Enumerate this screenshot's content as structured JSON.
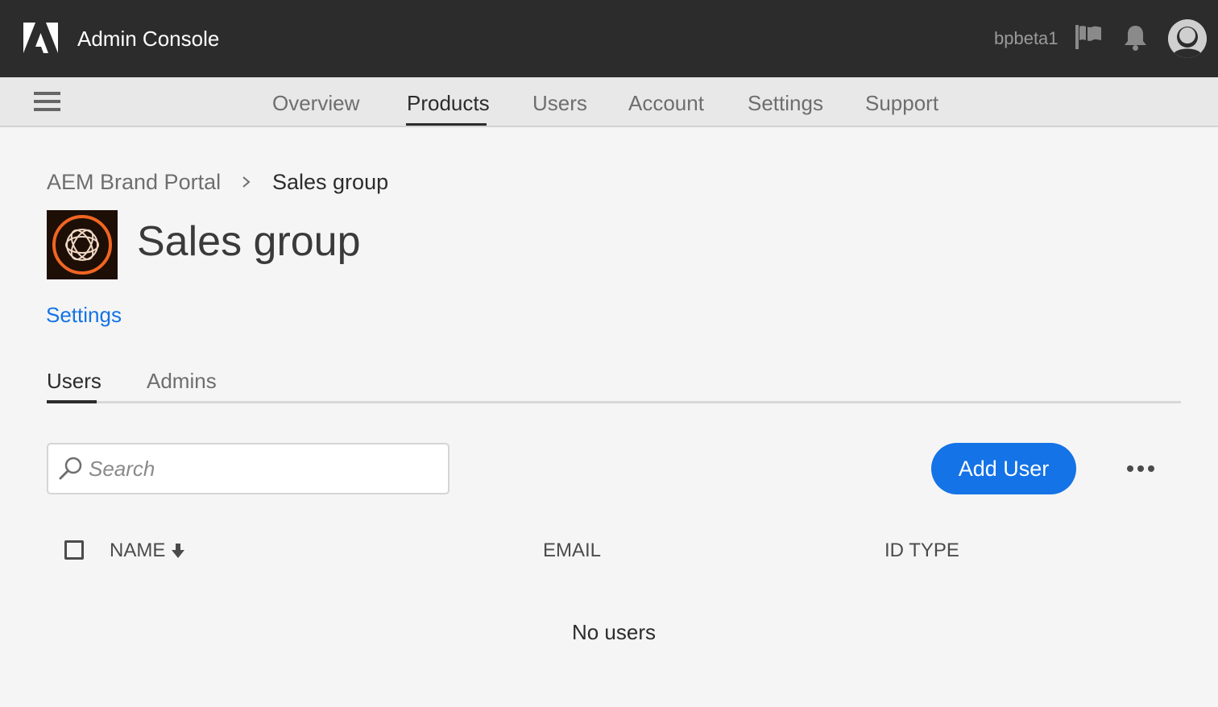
{
  "header": {
    "app_title": "Admin Console",
    "username": "bpbeta1",
    "logo_icon": "adobe-logo-icon",
    "flag_icon": "flag-icon",
    "bell_icon": "bell-icon",
    "avatar_icon": "user-avatar-icon"
  },
  "nav": {
    "menu_icon": "hamburger-menu-icon",
    "tabs": [
      {
        "label": "Overview",
        "active": false
      },
      {
        "label": "Products",
        "active": true
      },
      {
        "label": "Users",
        "active": false
      },
      {
        "label": "Account",
        "active": false
      },
      {
        "label": "Settings",
        "active": false
      },
      {
        "label": "Support",
        "active": false
      }
    ]
  },
  "breadcrumb": {
    "parent": "AEM Brand Portal",
    "separator_icon": "chevron-right-icon",
    "current": "Sales group"
  },
  "product": {
    "title": "Sales group",
    "logo_icon": "experience-manager-logo-icon",
    "settings_link": "Settings"
  },
  "sub_tabs": [
    {
      "label": "Users",
      "active": true
    },
    {
      "label": "Admins",
      "active": false
    }
  ],
  "toolbar": {
    "search_placeholder": "Search",
    "search_value": "",
    "add_user_label": "Add User",
    "more_icon": "more-options-icon"
  },
  "table": {
    "columns": [
      "NAME",
      "EMAIL",
      "ID TYPE"
    ],
    "sort_column": "NAME",
    "sort_direction": "descending",
    "rows": [],
    "empty_message": "No users"
  },
  "colors": {
    "topbar_bg": "#2c2c2c",
    "navbar_bg": "#e8e8e8",
    "page_bg": "#f5f5f5",
    "accent_blue": "#1473e6",
    "product_logo_bg": "#1d0f06",
    "product_logo_ring": "#f26522"
  }
}
